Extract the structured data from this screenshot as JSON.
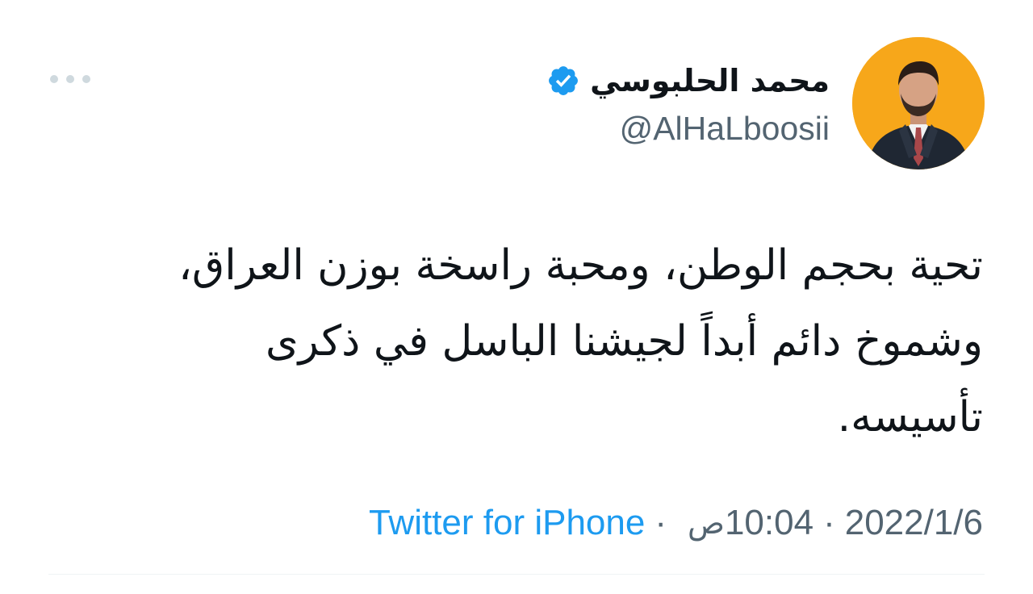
{
  "author": {
    "display_name": "محمد الحلبوسي",
    "handle": "@AlHaLboosii",
    "verified": true,
    "verified_icon": "verified-badge-icon",
    "avatar_background": "#f7a71a"
  },
  "tweet": {
    "lines": [
      "تحية بحجم الوطن، ومحبة راسخة بوزن العراق،",
      "وشموخ دائم أبداً لجيشنا الباسل في ذكرى",
      "تأسيسه."
    ]
  },
  "meta": {
    "date": "2022/1/6",
    "time": "10:04",
    "am_pm": "ص",
    "separator": "·",
    "source": "Twitter for iPhone"
  },
  "more_icon": "more-horizontal-icon",
  "colors": {
    "text_primary": "#0f1419",
    "text_secondary": "#536471",
    "accent": "#1d9bf0",
    "dots": "#cfd9de",
    "divider": "#eff3f4"
  }
}
